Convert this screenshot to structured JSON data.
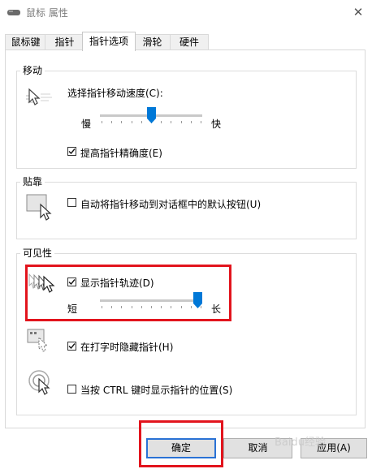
{
  "window": {
    "title": "鼠标 属性",
    "close_glyph": "✕"
  },
  "tabs": [
    {
      "label": "鼠标键",
      "active": false
    },
    {
      "label": "指针",
      "active": false
    },
    {
      "label": "指针选项",
      "active": true
    },
    {
      "label": "滑轮",
      "active": false
    },
    {
      "label": "硬件",
      "active": false
    }
  ],
  "motion": {
    "group_label": "移动",
    "speed_label": "选择指针移动速度(C):",
    "slow_label": "慢",
    "fast_label": "快",
    "speed_level": 0.5,
    "precision_label": "提高指针精确度(E)",
    "precision_checked": true
  },
  "snap": {
    "group_label": "贴靠",
    "snap_label": "自动将指针移动到对话框中的默认按钮(U)",
    "snap_checked": false
  },
  "visibility": {
    "group_label": "可见性",
    "trails_label": "显示指针轨迹(D)",
    "trails_checked": true,
    "short_label": "短",
    "long_label": "长",
    "trails_level": 1.0,
    "hide_label": "在打字时隐藏指针(H)",
    "hide_checked": true,
    "ctrl_label": "当按 CTRL 键时显示指针的位置(S)",
    "ctrl_checked": false
  },
  "buttons": {
    "ok": "确定",
    "cancel": "取消",
    "apply": "应用(A)"
  },
  "watermark": "Baidu经验",
  "colors": {
    "accent": "#0078d7",
    "highlight_box": "#e2141d"
  },
  "icons": {
    "app": "mouse-icon",
    "speed": "pointer-speed-icon",
    "snap": "snap-to-icon",
    "trails": "pointer-trails-icon",
    "hide": "hide-pointer-icon",
    "ctrl": "pointer-location-icon"
  }
}
